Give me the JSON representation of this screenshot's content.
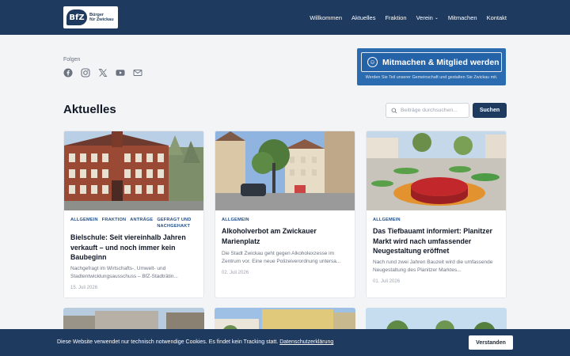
{
  "header": {
    "logo_mark": "BfZ",
    "logo_line1": "Bürger",
    "logo_line2": "für Zwickau",
    "nav": [
      "Willkommen",
      "Aktuelles",
      "Fraktion",
      "Verein",
      "Mitmachen",
      "Kontakt"
    ]
  },
  "social": {
    "label": "Folgen",
    "icons": [
      "facebook-icon",
      "instagram-icon",
      "x-icon",
      "youtube-icon",
      "mail-icon"
    ]
  },
  "cta": {
    "label": "Mitmachen & Mitglied werden",
    "subtitle": "Werden Sie Teil unserer Gemeinschaft und gestalten Sie Zwickau mit."
  },
  "aktuelles": {
    "title": "Aktuelles",
    "search_placeholder": "Beiträge durchsuchen...",
    "search_button": "Suchen"
  },
  "posts": [
    {
      "categories": [
        "ALLGEMEIN",
        "FRAKTION",
        "ANTRÄGE",
        "GEFRAGT UND NACHGEHAKT"
      ],
      "title": "Bielschule: Seit viereinhalb Jahren verkauft – und noch immer kein Baubeginn",
      "excerpt": "Nachgefragt im Wirtschafts-, Umwelt- und Stadtentwicklungsausschuss – BfZ-Stadträtin...",
      "date": "15. Juli 2026"
    },
    {
      "categories": [
        "ALLGEMEIN"
      ],
      "title": "Alkoholverbot am Zwickauer Marienplatz",
      "excerpt": "Die Stadt Zwickau geht gegen Alkoholexzesse im Zentrum vor. Eine neue Polizeiverordnung untersa...",
      "date": "02. Juli 2026"
    },
    {
      "categories": [
        "ALLGEMEIN"
      ],
      "title": "Das Tiefbauamt informiert: Planitzer Markt wird nach umfassender Neugestaltung eröffnet",
      "excerpt": "Nach rund zwei Jahren Bauzeit wird die umfassende Neugestaltung des Planitzer Marktes...",
      "date": "01. Juli 2026"
    }
  ],
  "cookie": {
    "text": "Diese Website verwendet nur technisch notwendige Cookies. Es findet kein Tracking statt.",
    "link": "Datenschutzerklärung",
    "button": "Verstanden"
  },
  "colors": {
    "primary": "#1f3a5f",
    "accent": "#2b6cb0",
    "category": "#1f4e8c"
  }
}
